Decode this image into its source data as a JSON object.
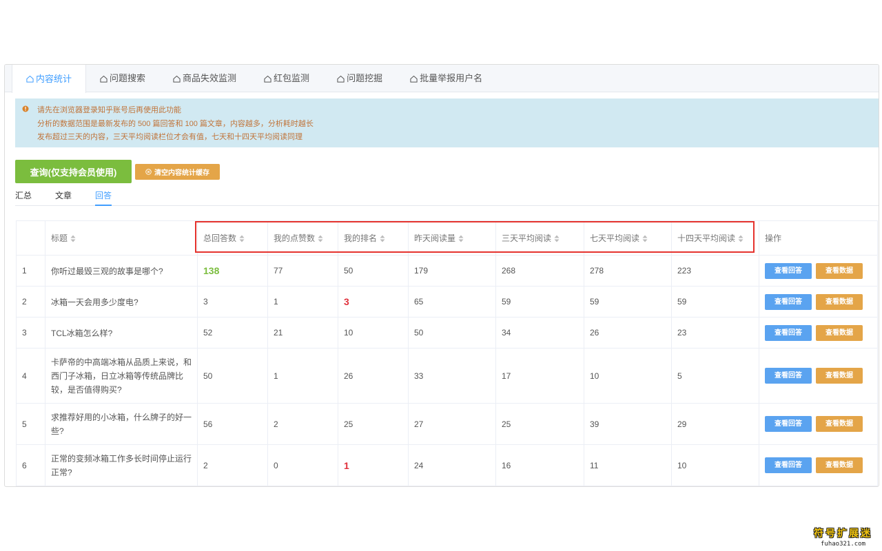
{
  "tabs": [
    {
      "label": "内容统计",
      "active": true
    },
    {
      "label": "问题搜索",
      "active": false
    },
    {
      "label": "商品失效监测",
      "active": false
    },
    {
      "label": "红包监测",
      "active": false
    },
    {
      "label": "问题挖掘",
      "active": false
    },
    {
      "label": "批量举报用户名",
      "active": false
    }
  ],
  "alert": {
    "lines": [
      "请先在浏览器登录知乎账号后再使用此功能",
      "分析的数据范围是最新发布的 500 篇回答和 100 篇文章，内容越多，分析耗时越长",
      "发布超过三天的内容，三天平均阅读栏位才会有值，七天和十四天平均阅读同理"
    ]
  },
  "buttons": {
    "query": "查询(仅支持会员使用)",
    "clear_cache": "清空内容统计缓存"
  },
  "subtabs": [
    {
      "label": "汇总",
      "active": false
    },
    {
      "label": "文章",
      "active": false
    },
    {
      "label": "回答",
      "active": true
    }
  ],
  "table": {
    "headers": [
      "",
      "标题",
      "总回答数",
      "我的点赞数",
      "我的排名",
      "昨天阅读量",
      "三天平均阅读",
      "七天平均阅读",
      "十四天平均阅读",
      "操作"
    ],
    "view_answer": "查看回答",
    "view_data": "查看数据",
    "rows": [
      {
        "idx": "1",
        "title": "你听过最毁三观的故事是哪个?",
        "total": "138",
        "likes": "77",
        "rank": "50",
        "yesterday": "179",
        "avg3": "268",
        "avg7": "278",
        "avg14": "223"
      },
      {
        "idx": "2",
        "title": "冰箱一天会用多少度电?",
        "total": "3",
        "likes": "1",
        "rank": "3",
        "yesterday": "65",
        "avg3": "59",
        "avg7": "59",
        "avg14": "59"
      },
      {
        "idx": "3",
        "title": "TCL冰箱怎么样?",
        "total": "52",
        "likes": "21",
        "rank": "10",
        "yesterday": "50",
        "avg3": "34",
        "avg7": "26",
        "avg14": "23"
      },
      {
        "idx": "4",
        "title": "卡萨帝的中高端冰箱从品质上来说，和西门子冰箱，日立冰箱等传统品牌比较，是否值得购买?",
        "total": "50",
        "likes": "1",
        "rank": "26",
        "yesterday": "33",
        "avg3": "17",
        "avg7": "10",
        "avg14": "5"
      },
      {
        "idx": "5",
        "title": "求推荐好用的小冰箱，什么牌子的好一些?",
        "total": "56",
        "likes": "2",
        "rank": "25",
        "yesterday": "27",
        "avg3": "25",
        "avg7": "39",
        "avg14": "29"
      },
      {
        "idx": "6",
        "title": "正常的变频冰箱工作多长时间停止运行正常?",
        "total": "2",
        "likes": "0",
        "rank": "1",
        "yesterday": "24",
        "avg3": "16",
        "avg7": "11",
        "avg14": "10"
      }
    ]
  },
  "watermark": {
    "cn": "符号扩展迷",
    "en": "fuhao321.com"
  },
  "colors": {
    "accent": "#409eff",
    "green": "#7bbd3e",
    "orange": "#e4a548",
    "red": "#e0303b",
    "alert_bg": "#d1e9f2"
  }
}
